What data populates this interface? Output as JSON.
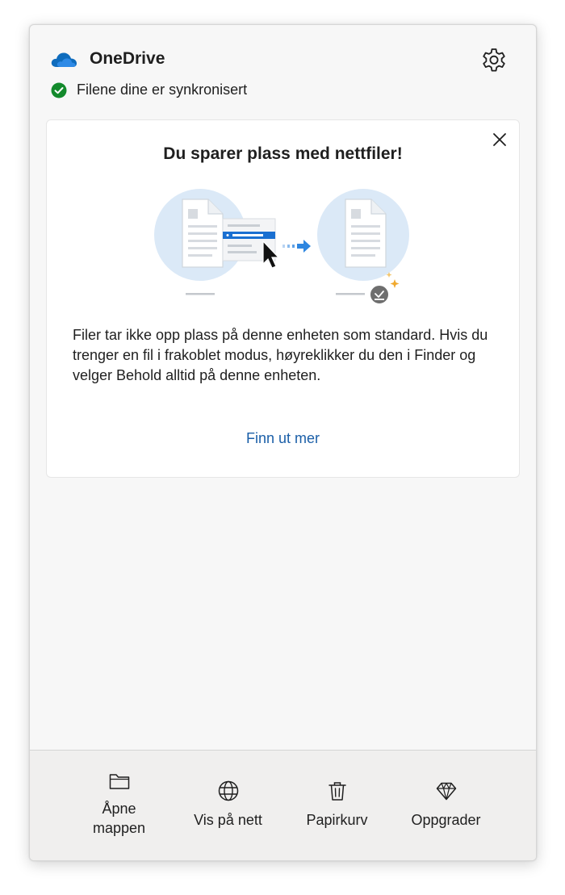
{
  "app": {
    "title": "OneDrive",
    "status": "Filene dine er synkronisert",
    "status_color": "#138a2c",
    "brand_color": "#0f6cbd"
  },
  "icons": {
    "logo": "onedrive-cloud-icon",
    "settings": "gear-icon",
    "status": "check-circle-icon",
    "close": "close-icon"
  },
  "card": {
    "title": "Du sparer plass med nettfiler!",
    "body": "Filer tar ikke opp plass på denne enheten som standard. Hvis du trenger en fil i frakoblet modus, høyreklikker du den i Finder og velger Behold alltid på denne enheten.",
    "link": "Finn ut mer",
    "link_color": "#1b5fa8"
  },
  "footer": {
    "items": [
      {
        "label": "Åpne\nmappen",
        "icon": "folder-icon"
      },
      {
        "label": "Vis på nett",
        "icon": "globe-icon"
      },
      {
        "label": "Papirkurv",
        "icon": "trash-icon"
      },
      {
        "label": "Oppgrader",
        "icon": "diamond-icon"
      }
    ]
  }
}
